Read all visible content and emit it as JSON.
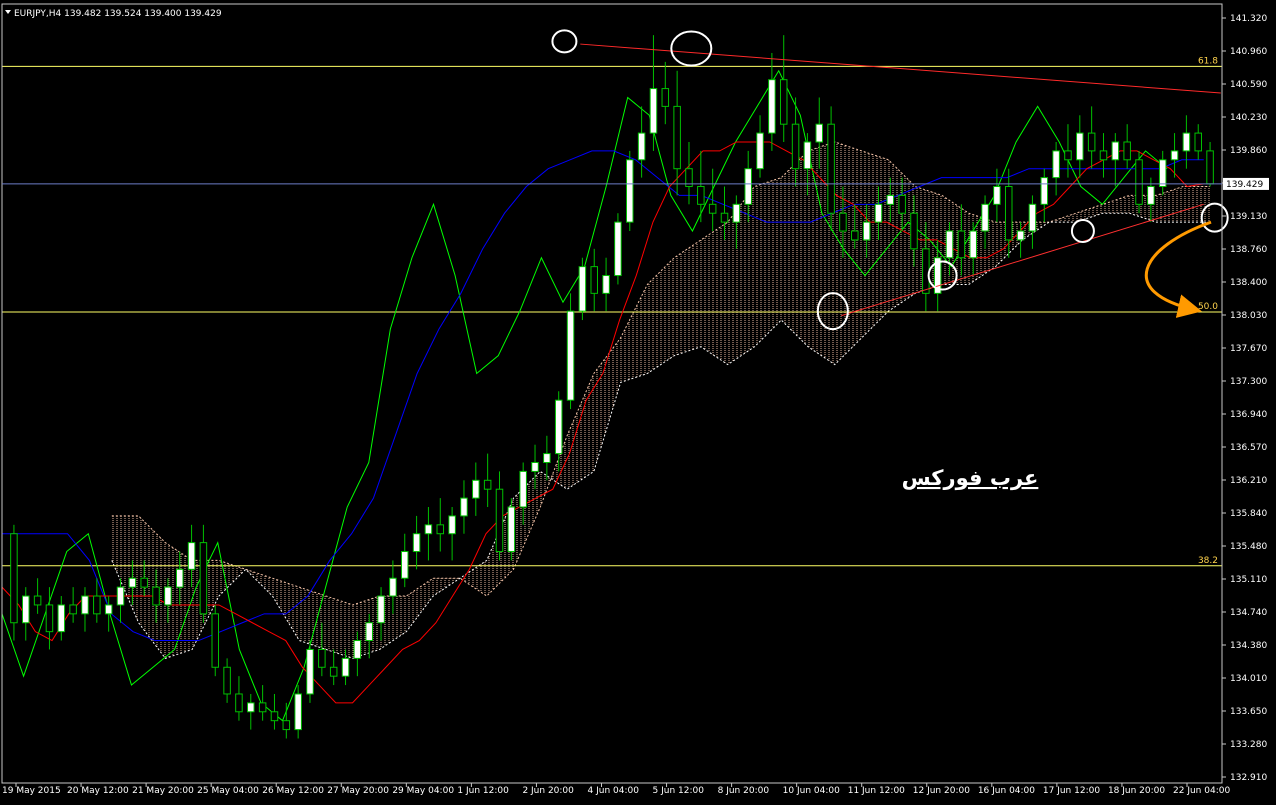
{
  "chart_data": {
    "type": "candlestick",
    "symbol_header": "EURJPY,H4  139.482 139.524 139.400 139.429",
    "current_price": 139.429,
    "current_price_label": "139.429",
    "ylim": [
      132.7,
      141.45
    ],
    "y_ticks": [
      "141.320",
      "140.960",
      "140.590",
      "140.230",
      "139.860",
      "139.490",
      "139.130",
      "138.760",
      "138.400",
      "138.030",
      "137.670",
      "137.300",
      "136.940",
      "136.570",
      "136.210",
      "135.840",
      "135.480",
      "135.110",
      "134.740",
      "134.380",
      "134.010",
      "133.650",
      "133.280",
      "132.910"
    ],
    "x_ticks": [
      "19 May 2015",
      "20 May 12:00",
      "21 May 20:00",
      "25 May 04:00",
      "26 May 12:00",
      "27 May 20:00",
      "29 May 04:00",
      "1 Jun 12:00",
      "2 Jun 20:00",
      "4 Jun 04:00",
      "5 Jun 12:00",
      "8 Jun 20:00",
      "10 Jun 04:00",
      "11 Jun 12:00",
      "12 Jun 20:00",
      "16 Jun 04:00",
      "17 Jun 12:00",
      "18 Jun 20:00",
      "22 Jun 04:00"
    ],
    "fib_levels": [
      {
        "label": "61.8",
        "value": 140.75
      },
      {
        "label": "50.0",
        "value": 137.99
      },
      {
        "label": "38.2",
        "value": 135.14
      }
    ],
    "watermark": "عرب فوركس",
    "colors": {
      "background": "#000000",
      "bull": "#ffffff",
      "bear": "#000000",
      "wick": "#00c000",
      "tenkan": "#ff0000",
      "kijun": "#0000ff",
      "chikou": "#00ff00",
      "cloud_a": "#f5c4a8",
      "cloud_b": "#ffffff",
      "fib": "#ffff66",
      "trend_top": "#ff2a2a",
      "trend_bottom": "#ff3030",
      "arrow": "#ff9a00",
      "circles": "#ffffff"
    },
    "candles": [
      [
        135.5,
        135.6,
        134.3,
        134.5
      ],
      [
        134.5,
        134.9,
        134.3,
        134.8
      ],
      [
        134.8,
        135.0,
        134.6,
        134.7
      ],
      [
        134.7,
        134.9,
        134.2,
        134.4
      ],
      [
        134.4,
        134.8,
        134.3,
        134.7
      ],
      [
        134.7,
        134.9,
        134.5,
        134.6
      ],
      [
        134.6,
        134.9,
        134.4,
        134.8
      ],
      [
        134.8,
        135.0,
        134.5,
        134.6
      ],
      [
        134.6,
        134.8,
        134.4,
        134.7
      ],
      [
        134.7,
        135.0,
        134.5,
        134.9
      ],
      [
        134.9,
        135.2,
        134.7,
        135.0
      ],
      [
        135.0,
        135.2,
        134.8,
        134.9
      ],
      [
        134.9,
        135.1,
        134.5,
        134.7
      ],
      [
        134.7,
        135.0,
        134.5,
        134.9
      ],
      [
        134.9,
        135.3,
        134.7,
        135.1
      ],
      [
        135.1,
        135.6,
        134.9,
        135.4
      ],
      [
        135.4,
        135.6,
        134.5,
        134.6
      ],
      [
        134.6,
        134.7,
        133.9,
        134.0
      ],
      [
        134.0,
        134.1,
        133.6,
        133.7
      ],
      [
        133.7,
        133.9,
        133.4,
        133.5
      ],
      [
        133.5,
        133.7,
        133.3,
        133.6
      ],
      [
        133.6,
        133.8,
        133.4,
        133.5
      ],
      [
        133.5,
        133.7,
        133.3,
        133.4
      ],
      [
        133.4,
        133.6,
        133.2,
        133.3
      ],
      [
        133.3,
        133.8,
        133.2,
        133.7
      ],
      [
        133.7,
        134.3,
        133.6,
        134.2
      ],
      [
        134.2,
        134.5,
        133.9,
        134.0
      ],
      [
        134.0,
        134.2,
        133.8,
        133.9
      ],
      [
        133.9,
        134.2,
        133.8,
        134.1
      ],
      [
        134.1,
        134.4,
        133.9,
        134.3
      ],
      [
        134.3,
        134.6,
        134.1,
        134.5
      ],
      [
        134.5,
        134.9,
        134.3,
        134.8
      ],
      [
        134.8,
        135.2,
        134.6,
        135.0
      ],
      [
        135.0,
        135.5,
        134.9,
        135.3
      ],
      [
        135.3,
        135.7,
        135.1,
        135.5
      ],
      [
        135.5,
        135.8,
        135.2,
        135.6
      ],
      [
        135.6,
        135.9,
        135.3,
        135.5
      ],
      [
        135.5,
        135.8,
        135.2,
        135.7
      ],
      [
        135.7,
        136.1,
        135.5,
        135.9
      ],
      [
        135.9,
        136.3,
        135.7,
        136.1
      ],
      [
        136.1,
        136.4,
        135.8,
        136.0
      ],
      [
        136.0,
        136.2,
        135.2,
        135.3
      ],
      [
        135.3,
        135.9,
        135.2,
        135.8
      ],
      [
        135.8,
        136.3,
        135.6,
        136.2
      ],
      [
        136.2,
        136.5,
        136.0,
        136.3
      ],
      [
        136.3,
        136.6,
        136.1,
        136.4
      ],
      [
        136.4,
        137.1,
        136.2,
        137.0
      ],
      [
        137.0,
        138.2,
        136.9,
        138.0
      ],
      [
        138.0,
        138.6,
        137.9,
        138.5
      ],
      [
        138.5,
        138.7,
        138.0,
        138.2
      ],
      [
        138.2,
        138.6,
        138.0,
        138.4
      ],
      [
        138.4,
        139.1,
        138.3,
        139.0
      ],
      [
        139.0,
        139.8,
        138.9,
        139.7
      ],
      [
        139.7,
        140.3,
        139.5,
        140.0
      ],
      [
        140.0,
        141.1,
        139.8,
        140.5
      ],
      [
        140.5,
        140.8,
        140.1,
        140.3
      ],
      [
        140.3,
        140.7,
        139.3,
        139.6
      ],
      [
        139.6,
        139.9,
        139.2,
        139.4
      ],
      [
        139.4,
        139.8,
        139.0,
        139.2
      ],
      [
        139.2,
        139.6,
        138.9,
        139.1
      ],
      [
        139.1,
        139.4,
        138.8,
        139.0
      ],
      [
        139.0,
        139.3,
        138.7,
        139.2
      ],
      [
        139.2,
        139.8,
        139.0,
        139.6
      ],
      [
        139.6,
        140.2,
        139.5,
        140.0
      ],
      [
        140.0,
        140.9,
        139.8,
        140.6
      ],
      [
        140.6,
        141.1,
        139.9,
        140.1
      ],
      [
        140.1,
        140.4,
        139.4,
        139.6
      ],
      [
        139.6,
        140.0,
        139.3,
        139.9
      ],
      [
        139.9,
        140.4,
        139.6,
        140.1
      ],
      [
        140.1,
        140.3,
        138.9,
        139.1
      ],
      [
        139.1,
        139.4,
        138.6,
        138.9
      ],
      [
        138.9,
        139.2,
        138.7,
        138.8
      ],
      [
        138.8,
        139.2,
        138.6,
        139.0
      ],
      [
        139.0,
        139.4,
        138.8,
        139.2
      ],
      [
        139.2,
        139.5,
        139.0,
        139.3
      ],
      [
        139.3,
        139.5,
        138.9,
        139.1
      ],
      [
        139.1,
        139.3,
        138.5,
        138.7
      ],
      [
        138.7,
        139.0,
        138.0,
        138.2
      ],
      [
        138.2,
        138.8,
        138.0,
        138.6
      ],
      [
        138.6,
        139.0,
        138.4,
        138.9
      ],
      [
        138.9,
        139.2,
        138.4,
        138.6
      ],
      [
        138.6,
        139.0,
        138.4,
        138.9
      ],
      [
        138.9,
        139.3,
        138.7,
        139.2
      ],
      [
        139.2,
        139.6,
        139.0,
        139.4
      ],
      [
        139.4,
        139.6,
        138.6,
        138.8
      ],
      [
        138.8,
        139.0,
        138.6,
        138.9
      ],
      [
        138.9,
        139.3,
        138.7,
        139.2
      ],
      [
        139.2,
        139.6,
        139.0,
        139.5
      ],
      [
        139.5,
        139.9,
        139.3,
        139.8
      ],
      [
        139.8,
        140.1,
        139.5,
        139.7
      ],
      [
        139.7,
        140.2,
        139.5,
        140.0
      ],
      [
        140.0,
        140.3,
        139.6,
        139.8
      ],
      [
        139.8,
        140.0,
        139.5,
        139.7
      ],
      [
        139.7,
        140.0,
        139.4,
        139.9
      ],
      [
        139.9,
        140.1,
        139.6,
        139.7
      ],
      [
        139.7,
        139.8,
        139.1,
        139.2
      ],
      [
        139.2,
        139.5,
        139.0,
        139.4
      ],
      [
        139.4,
        139.8,
        139.3,
        139.7
      ],
      [
        139.7,
        140.0,
        139.5,
        139.8
      ],
      [
        139.8,
        140.2,
        139.6,
        140.0
      ],
      [
        140.0,
        140.1,
        139.7,
        139.8
      ],
      [
        139.8,
        139.9,
        139.4,
        139.43
      ]
    ],
    "tenkan": [
      134.9,
      134.7,
      134.4,
      134.3,
      134.6,
      134.8,
      134.8,
      134.8,
      134.8,
      134.8,
      134.7,
      134.7,
      134.7,
      134.7,
      134.6,
      134.5,
      134.4,
      134.3,
      134.0,
      133.8,
      133.6,
      133.6,
      133.8,
      134.0,
      134.2,
      134.3,
      134.5,
      134.8,
      135.1,
      135.5,
      135.7,
      135.8,
      135.9,
      136.0,
      136.4,
      137.0,
      137.3,
      137.9,
      138.4,
      139.0,
      139.4,
      139.6,
      139.8,
      139.8,
      139.9,
      139.9,
      139.9,
      139.8,
      139.7,
      139.5,
      139.3,
      139.2,
      139.0,
      139.0,
      138.9,
      138.8,
      138.8,
      138.7,
      138.6,
      138.6,
      138.7,
      138.9,
      139.1,
      139.2,
      139.4,
      139.6,
      139.7,
      139.8,
      139.8,
      139.7,
      139.6,
      139.4,
      139.43
    ],
    "kijun": [
      135.5,
      135.5,
      135.5,
      135.5,
      135.2,
      134.6,
      134.4,
      134.3,
      134.3,
      134.3,
      134.4,
      134.5,
      134.6,
      134.6,
      134.8,
      135.2,
      135.5,
      135.9,
      136.6,
      137.3,
      137.8,
      138.2,
      138.7,
      139.1,
      139.4,
      139.6,
      139.7,
      139.8,
      139.8,
      139.7,
      139.5,
      139.3,
      139.3,
      139.2,
      139.1,
      139.0,
      139.0,
      139.0,
      139.1,
      139.2,
      139.2,
      139.3,
      139.4,
      139.5,
      139.5,
      139.5,
      139.5,
      139.6,
      139.6,
      139.6,
      139.6,
      139.6,
      139.6,
      139.6,
      139.7,
      139.7
    ],
    "chikou": [
      134.6,
      133.9,
      134.6,
      135.3,
      135.5,
      134.6,
      133.8,
      134.0,
      134.2,
      134.9,
      135.4,
      134.2,
      133.6,
      133.4,
      134.0,
      134.9,
      135.8,
      136.3,
      137.8,
      138.6,
      139.2,
      138.4,
      137.3,
      137.5,
      138.0,
      138.6,
      138.1,
      138.5,
      139.4,
      140.4,
      140.2,
      139.3,
      138.9,
      139.4,
      139.9,
      140.3,
      140.7,
      140.2,
      139.1,
      138.7,
      138.4,
      138.7,
      139.0,
      138.8,
      138.5,
      138.9,
      139.3,
      139.9,
      140.3,
      139.9,
      139.4,
      139.2,
      139.5,
      139.8,
      139.6
    ],
    "cloud_top": [
      135.7,
      135.7,
      135.4,
      135.2,
      135.2,
      135.1,
      135.0,
      134.9,
      134.8,
      134.7,
      134.8,
      134.8,
      135.0,
      135.0,
      134.8,
      135.1,
      135.8,
      136.6,
      137.3,
      137.7,
      138.3,
      138.6,
      138.8,
      139.0,
      139.4,
      139.5,
      139.8,
      139.9,
      139.8,
      139.7,
      139.4,
      139.3,
      139.1,
      139.0,
      139.0,
      139.0,
      139.1,
      139.2,
      139.3,
      139.3,
      139.4,
      139.4
    ],
    "cloud_bottom": [
      135.2,
      134.5,
      134.1,
      134.2,
      134.8,
      135.1,
      134.8,
      134.3,
      134.2,
      134.1,
      134.2,
      134.4,
      134.8,
      135.0,
      135.2,
      135.9,
      136.2,
      136.0,
      136.2,
      137.2,
      137.3,
      137.5,
      137.6,
      137.4,
      137.6,
      137.9,
      137.6,
      137.4,
      137.7,
      138.0,
      138.2,
      138.3,
      138.3,
      138.5,
      138.8,
      139.0,
      139.0,
      139.1,
      139.1,
      139.0,
      139.0,
      139.0
    ],
    "trendlines": [
      {
        "name": "top",
        "x1": 0.474,
        "v1": 141.0,
        "x2": 0.999,
        "v2": 140.45
      },
      {
        "name": "bottom",
        "x1": 0.688,
        "v1": 137.95,
        "x2": 0.985,
        "v2": 139.2
      }
    ],
    "circle_marks": [
      {
        "cx": 0.461,
        "v": 141.03,
        "rx": 12,
        "ry": 11
      },
      {
        "cx": 0.565,
        "v": 140.95,
        "rx": 20,
        "ry": 17
      },
      {
        "cx": 0.681,
        "v": 138.0,
        "rx": 15,
        "ry": 18
      },
      {
        "cx": 0.771,
        "v": 138.4,
        "rx": 14,
        "ry": 14
      },
      {
        "cx": 0.886,
        "v": 138.9,
        "rx": 11,
        "ry": 11
      },
      {
        "cx": 0.994,
        "v": 139.05,
        "rx": 13,
        "ry": 14
      }
    ]
  }
}
